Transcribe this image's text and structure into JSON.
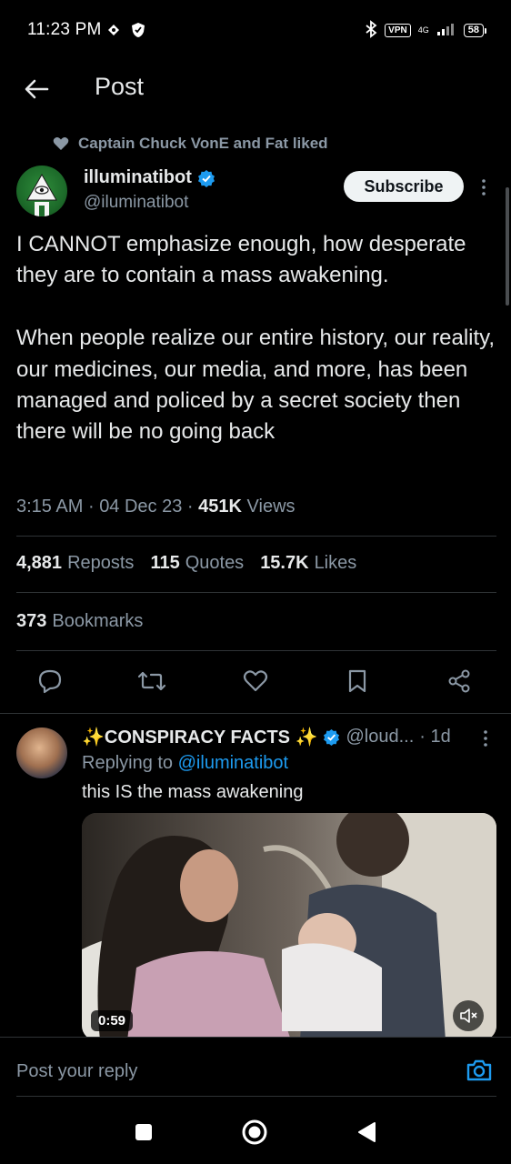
{
  "status_bar": {
    "time": "11:23 PM",
    "vpn": "VPN",
    "network": "4G",
    "battery": "58"
  },
  "topbar": {
    "title": "Post"
  },
  "social_context": {
    "text": "Captain Chuck VonE and Fat liked"
  },
  "author": {
    "name": "illuminatibot",
    "handle": "@iluminatibot",
    "subscribe_label": "Subscribe"
  },
  "post": {
    "text": "I CANNOT emphasize enough, how desperate they are to contain a mass awakening.\n\nWhen people realize our entire history, our reality, our medicines, our media, and more, has been managed and policed by a secret society then there will be no going back",
    "time": "3:15 AM",
    "date": "04 Dec 23",
    "views_count": "451K",
    "views_label": "Views",
    "sep": "·"
  },
  "stats": {
    "reposts_count": "4,881",
    "reposts_label": "Reposts",
    "quotes_count": "115",
    "quotes_label": "Quotes",
    "likes_count": "15.7K",
    "likes_label": "Likes",
    "bookmarks_count": "373",
    "bookmarks_label": "Bookmarks"
  },
  "reply": {
    "name": "✨CONSPIRACY FACTS ✨",
    "handle": "@loud...",
    "age": "· 1d",
    "replying_prefix": "Replying to",
    "replying_handle": "@iluminatibot",
    "text": "this IS the mass awakening",
    "video_duration": "0:59"
  },
  "composer": {
    "placeholder": "Post your reply"
  },
  "colors": {
    "accent": "#1d9bf0",
    "background": "#000000",
    "muted": "#8b98a5"
  }
}
